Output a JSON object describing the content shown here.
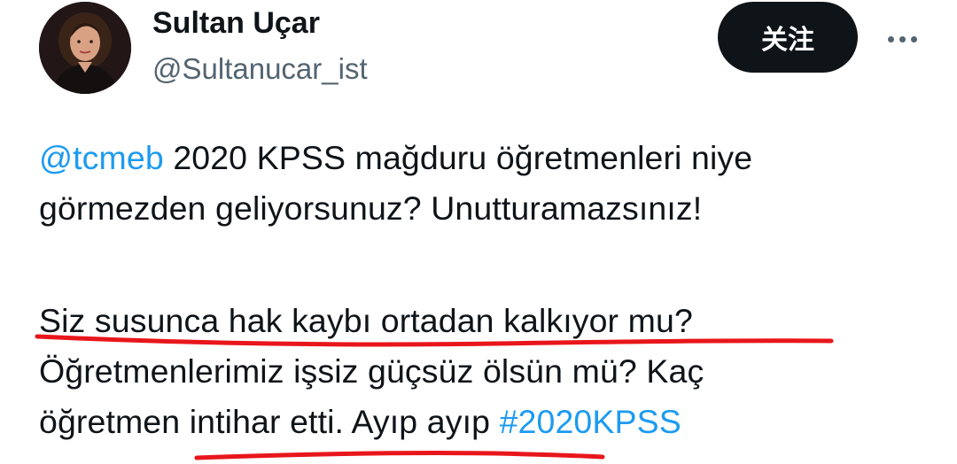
{
  "user": {
    "display_name": "Sultan Uçar",
    "handle": "@Sultanucar_ist",
    "avatar_icon": "profile-photo"
  },
  "actions": {
    "follow_label": "关注",
    "more_icon": "more-horizontal-icon"
  },
  "tweet": {
    "mention": "@tcmeb",
    "line1_rest": " 2020 KPSS mağduru öğretmenleri niye",
    "line2": "görmezden geliyorsunuz? Unutturamazsınız!",
    "line3": "Siz susunca hak kaybı ortadan kalkıyor mu?",
    "line4": "Öğretmenlerimiz işsiz güçsüz ölsün mü? Kaç",
    "line5_text": "öğretmen intihar etti. Ayıp ayıp ",
    "hashtag": "#2020KPSS"
  },
  "colors": {
    "link": "#1d9bf0",
    "text": "#0f1419",
    "secondary": "#536471",
    "button_bg": "#0f1419",
    "annotation_red": "#e8161b"
  }
}
